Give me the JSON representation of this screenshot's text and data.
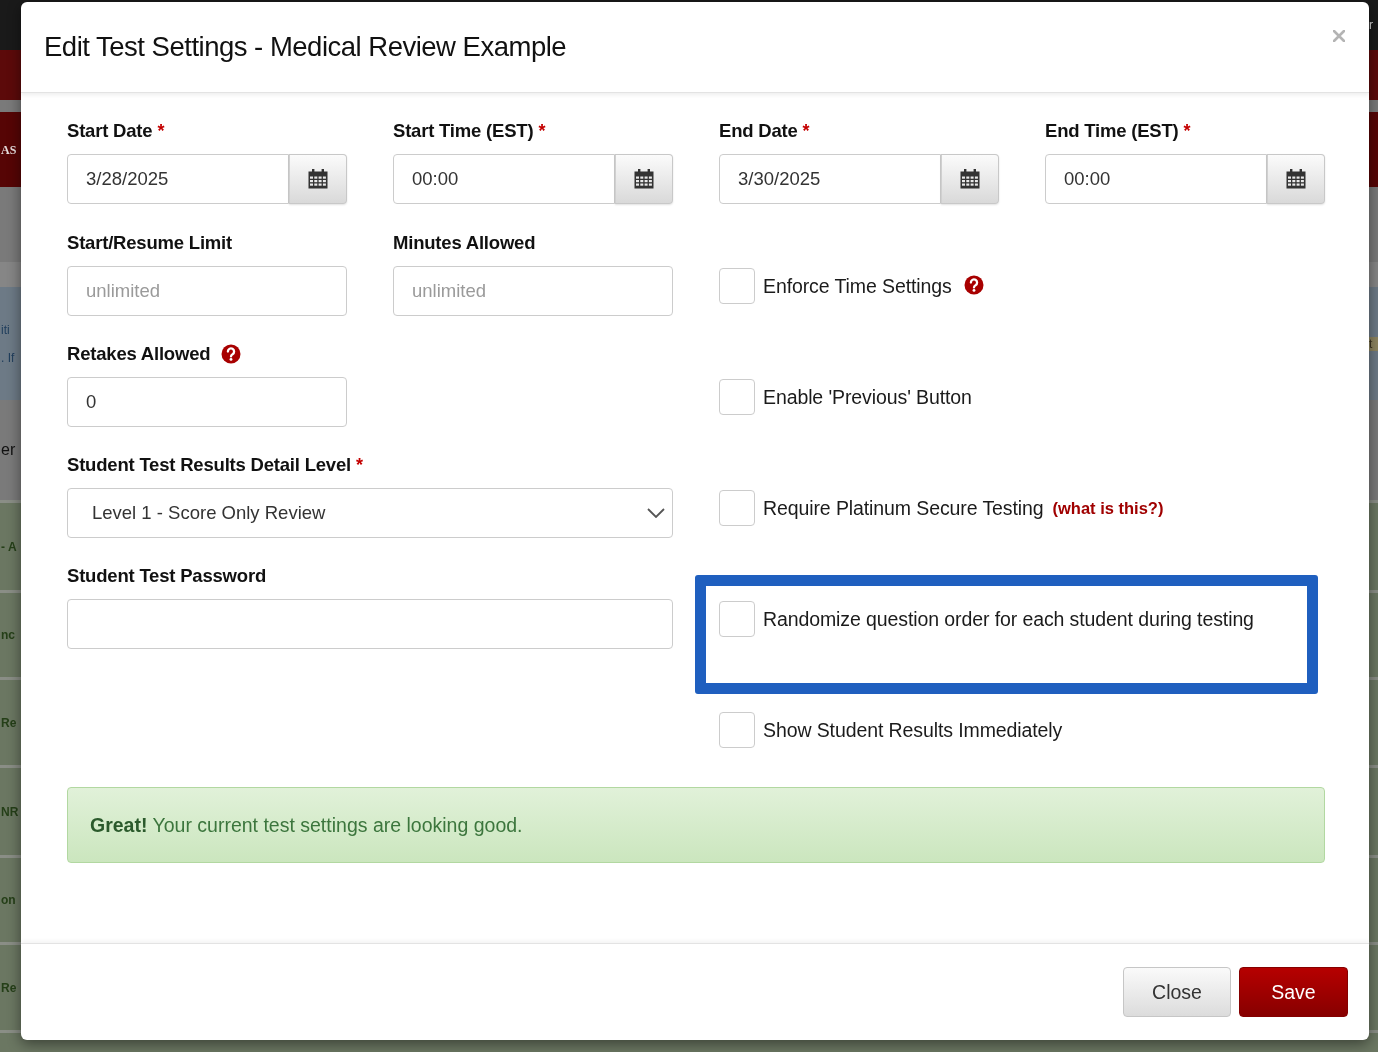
{
  "background_page": {
    "left_edge_texts": [
      "AS",
      "iti",
      ". If",
      "er",
      "- A",
      "nc",
      "Re",
      "NR",
      "on",
      "Re"
    ],
    "right_edge_texts": [
      "r",
      "t"
    ]
  },
  "dialog": {
    "title": "Edit Test Settings - Medical Review Example",
    "schedule_fields": [
      {
        "label": "Start Date",
        "required_mark": "*",
        "kind": "picker",
        "value": "3/28/2025"
      },
      {
        "label": "Start Time (EST)",
        "required_mark": "*",
        "kind": "picker",
        "value": "00:00"
      },
      {
        "label": "End Date",
        "required_mark": "*",
        "kind": "picker",
        "value": "3/30/2025"
      },
      {
        "label": "End Time (EST)",
        "required_mark": "*",
        "kind": "picker",
        "value": "00:00"
      }
    ],
    "fields": [
      {
        "label": "Start/Resume Limit",
        "kind": "number",
        "placeholder": "unlimited",
        "help_icon": false
      },
      {
        "label": "Minutes Allowed",
        "kind": "number",
        "placeholder": "unlimited",
        "help_icon": false
      },
      {
        "label": "Retakes Allowed",
        "kind": "number",
        "value": "0",
        "help_icon": true
      },
      {
        "label": "Student Test Results Detail Level",
        "required_mark": "*",
        "kind": "select",
        "value": "Level 1 - Score Only Review",
        "help_icon": false
      },
      {
        "label": "Student Test Password",
        "kind": "password",
        "help_icon": false
      }
    ],
    "options": [
      {
        "label": "Enforce Time Settings",
        "checked": false,
        "help_icon": true,
        "highlighted": false
      },
      {
        "label": "Enable 'Previous' Button",
        "checked": false,
        "help_icon": false,
        "highlighted": false
      },
      {
        "label": "Require Platinum Secure Testing",
        "checked": false,
        "help_icon": false,
        "highlighted": false,
        "link": "(what is this?)"
      },
      {
        "label": "Randomize question order for each student during testing",
        "checked": false,
        "help_icon": false,
        "highlighted": true
      },
      {
        "label": "Show Student Results Immediately",
        "checked": false,
        "help_icon": false,
        "highlighted": false
      }
    ],
    "alert": {
      "text": "**Great!** Your current test settings are looking good."
    },
    "buttons": [
      {
        "label": "Close",
        "kind": "secondary"
      },
      {
        "label": "Save",
        "kind": "primary"
      }
    ]
  }
}
